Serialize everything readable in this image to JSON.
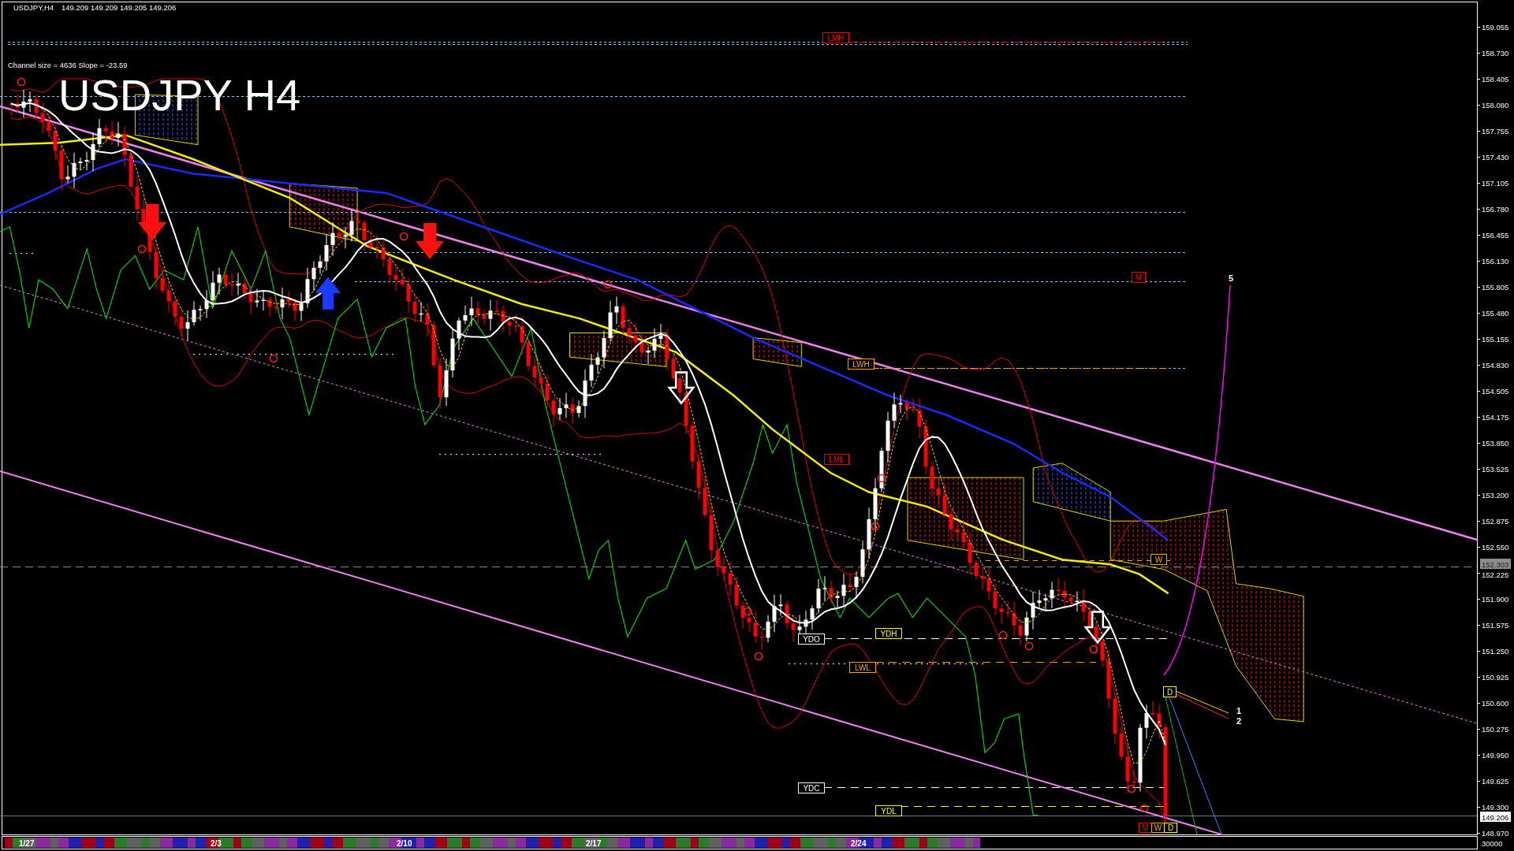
{
  "header": {
    "symbol": "USDJPY,H4",
    "quotes": [
      "149.209",
      "149.209",
      "149.205",
      "149.206"
    ]
  },
  "channel_info": "Channel size = 4636 Slope = -23.59",
  "chart_title": "USDJPY H4",
  "level_tags": [
    {
      "text": "LMH",
      "color": "#ff0000"
    },
    {
      "text": "M",
      "color": "#ff0000"
    },
    {
      "text": "LWH",
      "color": "#ffa500"
    },
    {
      "text": "LML",
      "color": "#ff0000"
    },
    {
      "text": "W",
      "color": "#ffa500"
    },
    {
      "text": "YDH",
      "color": "#ffff00"
    },
    {
      "text": "YDO",
      "color": "#ffffff"
    },
    {
      "text": "LWL",
      "color": "#ffa500"
    },
    {
      "text": "D",
      "color": "#ffff00"
    },
    {
      "text": "YDC",
      "color": "#ffffff"
    },
    {
      "text": "YDL",
      "color": "#ffff00"
    },
    {
      "text": "M",
      "color": "#ff0000"
    },
    {
      "text": "W",
      "color": "#ffa500"
    },
    {
      "text": "D",
      "color": "#ffff00"
    }
  ],
  "wave_labels": [
    "5",
    "1",
    "2"
  ],
  "price_axis": {
    "labels": [
      "159.055",
      "158.730",
      "158.405",
      "158.080",
      "157.755",
      "157.430",
      "157.105",
      "156.780",
      "156.455",
      "156.130",
      "155.805",
      "155.480",
      "155.155",
      "154.830",
      "154.505",
      "154.175",
      "153.850",
      "153.525",
      "153.200",
      "152.875",
      "152.550",
      "152.225",
      "151.900",
      "151.575",
      "151.250",
      "150.925",
      "150.600",
      "150.275",
      "149.950",
      "149.625",
      "149.300",
      "148.970"
    ],
    "price_line_tag": "152.303",
    "bid_tag": "149.206",
    "volume_label": "30000"
  },
  "time_axis": {
    "labels": [
      "1/27",
      "2/3",
      "2/10",
      "2/17",
      "2/24"
    ]
  }
}
